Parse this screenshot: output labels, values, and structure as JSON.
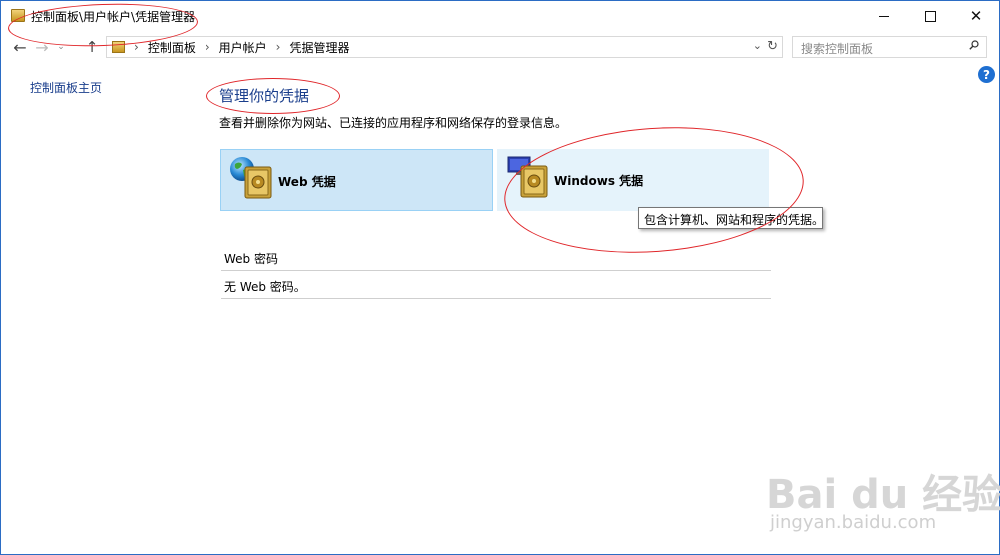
{
  "window": {
    "title": "控制面板\\用户帐户\\凭据管理器",
    "controls": {
      "minimize": "",
      "maximize": "",
      "close": "✕"
    }
  },
  "address_bar": {
    "breadcrumbs": [
      "控制面板",
      "用户帐户",
      "凭据管理器"
    ],
    "separator": "›"
  },
  "search": {
    "placeholder": "搜索控制面板"
  },
  "help": {
    "label": "?"
  },
  "sidebar": {
    "home_link": "控制面板主页"
  },
  "main": {
    "title": "管理你的凭据",
    "description": "查看并删除你为网站、已连接的应用程序和网络保存的登录信息。",
    "tiles": [
      {
        "label": "Web 凭据",
        "selected": true
      },
      {
        "label": "Windows 凭据",
        "selected": false
      }
    ],
    "tooltip": "包含计算机、网站和程序的凭据。",
    "section": {
      "header": "Web 密码",
      "empty_text": "无 Web 密码。"
    }
  },
  "watermark": {
    "brand": "Bai du 经验",
    "url": "jingyan.baidu.com"
  },
  "colors": {
    "link": "#1a3e8c",
    "tile_selected": "#cde6f7",
    "tile_hover": "#e5f3fb",
    "annotation": "#e0262a"
  }
}
